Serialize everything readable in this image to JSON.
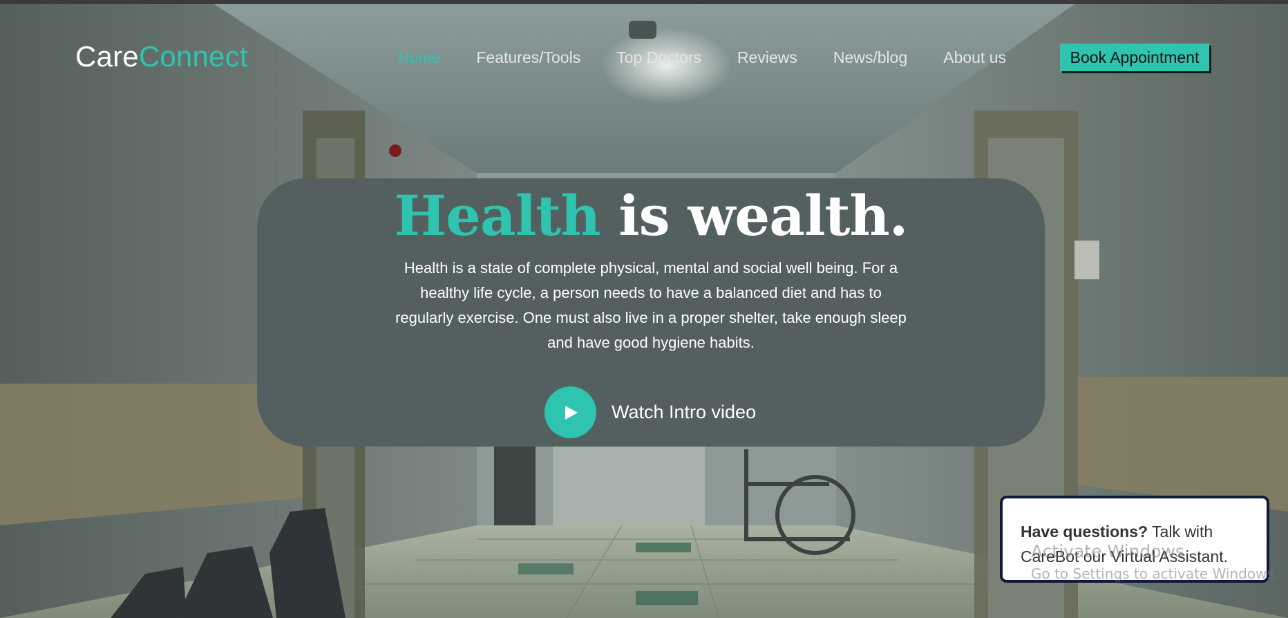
{
  "brand": {
    "part1": "Care",
    "part2": "Connect"
  },
  "nav": {
    "items": [
      {
        "label": "Home",
        "active": true
      },
      {
        "label": "Features/Tools",
        "active": false
      },
      {
        "label": "Top Doctors",
        "active": false
      },
      {
        "label": "Reviews",
        "active": false
      },
      {
        "label": "News/blog",
        "active": false
      },
      {
        "label": "About us",
        "active": false
      }
    ],
    "cta_label": "Book Appointment"
  },
  "hero": {
    "title_accent": "Health",
    "title_rest": " is wealth.",
    "text": "Health is a state of complete physical, mental and social well being. For a healthy life cycle, a person needs to have a balanced diet and has to regularly exercise. One must also live in a proper shelter, take enough sleep and have good hygiene habits.",
    "video_label": "Watch Intro video",
    "video_icon": "play-icon"
  },
  "chat": {
    "bold": "Have questions?",
    "text": " Talk with CareBot our Virtual Assistant."
  },
  "watermark": {
    "title": "Activate Windows",
    "subtitle": "Go to Settings to activate Windows."
  },
  "colors": {
    "accent": "#2ec4b0",
    "hero_card": "#53605f",
    "chat_border": "#121a3a"
  }
}
